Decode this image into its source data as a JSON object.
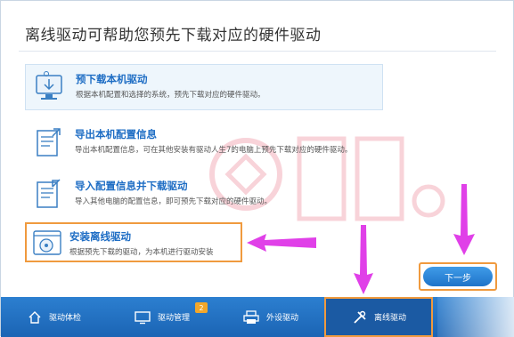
{
  "header": {
    "title": "离线驱动可帮助您预先下载对应的硬件驱动"
  },
  "options": [
    {
      "title": "预下载本机驱动",
      "desc": "根据本机配置和选择的系统，预先下载对应的硬件驱动。",
      "icon": "monitor-download-icon",
      "selected": true
    },
    {
      "title": "导出本机配置信息",
      "desc": "导出本机配置信息，可在其他安装有驱动人生7的电脑上预先下载对应的硬件驱动。",
      "icon": "document-export-icon",
      "selected": false
    },
    {
      "title": "导入配置信息并下载驱动",
      "desc": "导入其他电脑的配置信息，即可预先下载对应的硬件驱动。",
      "icon": "document-import-icon",
      "selected": false
    },
    {
      "title": "安装离线驱动",
      "desc": "根据预先下载的驱动，为本机进行驱动安装",
      "icon": "disc-install-icon",
      "selected": false
    }
  ],
  "next_button": {
    "label": "下一步"
  },
  "bottom_nav": [
    {
      "label": "驱动体检",
      "icon": "home-icon",
      "active": false
    },
    {
      "label": "驱动管理",
      "icon": "monitor-icon",
      "badge": "2",
      "active": false
    },
    {
      "label": "外设驱动",
      "icon": "printer-icon",
      "active": false
    },
    {
      "label": "离线驱动",
      "icon": "tools-icon",
      "active": true
    }
  ],
  "colors": {
    "accent_blue": "#1e6dc4",
    "highlight_orange": "#f09a3e",
    "annotation_magenta": "#e040e8",
    "nav_bar": "#2c7fd0"
  }
}
